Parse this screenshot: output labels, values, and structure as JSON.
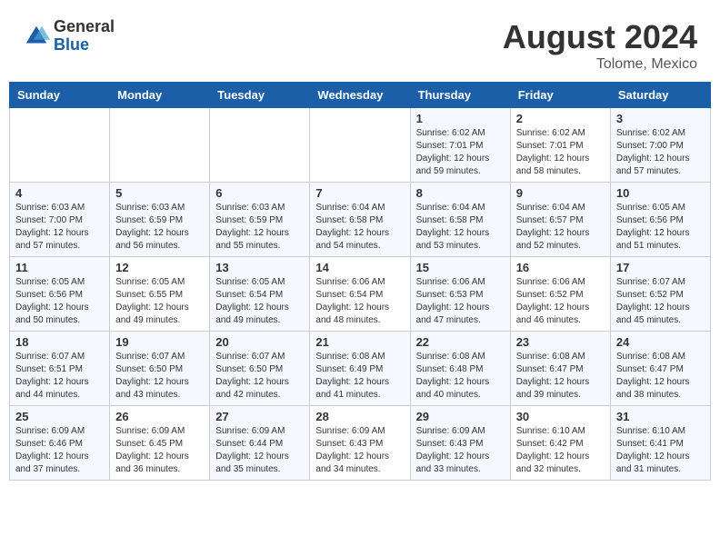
{
  "header": {
    "logo": {
      "general": "General",
      "blue": "Blue"
    },
    "month": "August 2024",
    "location": "Tolome, Mexico"
  },
  "weekdays": [
    "Sunday",
    "Monday",
    "Tuesday",
    "Wednesday",
    "Thursday",
    "Friday",
    "Saturday"
  ],
  "weeks": [
    [
      {
        "day": "",
        "info": ""
      },
      {
        "day": "",
        "info": ""
      },
      {
        "day": "",
        "info": ""
      },
      {
        "day": "",
        "info": ""
      },
      {
        "day": "1",
        "info": "Sunrise: 6:02 AM\nSunset: 7:01 PM\nDaylight: 12 hours\nand 59 minutes."
      },
      {
        "day": "2",
        "info": "Sunrise: 6:02 AM\nSunset: 7:01 PM\nDaylight: 12 hours\nand 58 minutes."
      },
      {
        "day": "3",
        "info": "Sunrise: 6:02 AM\nSunset: 7:00 PM\nDaylight: 12 hours\nand 57 minutes."
      }
    ],
    [
      {
        "day": "4",
        "info": "Sunrise: 6:03 AM\nSunset: 7:00 PM\nDaylight: 12 hours\nand 57 minutes."
      },
      {
        "day": "5",
        "info": "Sunrise: 6:03 AM\nSunset: 6:59 PM\nDaylight: 12 hours\nand 56 minutes."
      },
      {
        "day": "6",
        "info": "Sunrise: 6:03 AM\nSunset: 6:59 PM\nDaylight: 12 hours\nand 55 minutes."
      },
      {
        "day": "7",
        "info": "Sunrise: 6:04 AM\nSunset: 6:58 PM\nDaylight: 12 hours\nand 54 minutes."
      },
      {
        "day": "8",
        "info": "Sunrise: 6:04 AM\nSunset: 6:58 PM\nDaylight: 12 hours\nand 53 minutes."
      },
      {
        "day": "9",
        "info": "Sunrise: 6:04 AM\nSunset: 6:57 PM\nDaylight: 12 hours\nand 52 minutes."
      },
      {
        "day": "10",
        "info": "Sunrise: 6:05 AM\nSunset: 6:56 PM\nDaylight: 12 hours\nand 51 minutes."
      }
    ],
    [
      {
        "day": "11",
        "info": "Sunrise: 6:05 AM\nSunset: 6:56 PM\nDaylight: 12 hours\nand 50 minutes."
      },
      {
        "day": "12",
        "info": "Sunrise: 6:05 AM\nSunset: 6:55 PM\nDaylight: 12 hours\nand 49 minutes."
      },
      {
        "day": "13",
        "info": "Sunrise: 6:05 AM\nSunset: 6:54 PM\nDaylight: 12 hours\nand 49 minutes."
      },
      {
        "day": "14",
        "info": "Sunrise: 6:06 AM\nSunset: 6:54 PM\nDaylight: 12 hours\nand 48 minutes."
      },
      {
        "day": "15",
        "info": "Sunrise: 6:06 AM\nSunset: 6:53 PM\nDaylight: 12 hours\nand 47 minutes."
      },
      {
        "day": "16",
        "info": "Sunrise: 6:06 AM\nSunset: 6:52 PM\nDaylight: 12 hours\nand 46 minutes."
      },
      {
        "day": "17",
        "info": "Sunrise: 6:07 AM\nSunset: 6:52 PM\nDaylight: 12 hours\nand 45 minutes."
      }
    ],
    [
      {
        "day": "18",
        "info": "Sunrise: 6:07 AM\nSunset: 6:51 PM\nDaylight: 12 hours\nand 44 minutes."
      },
      {
        "day": "19",
        "info": "Sunrise: 6:07 AM\nSunset: 6:50 PM\nDaylight: 12 hours\nand 43 minutes."
      },
      {
        "day": "20",
        "info": "Sunrise: 6:07 AM\nSunset: 6:50 PM\nDaylight: 12 hours\nand 42 minutes."
      },
      {
        "day": "21",
        "info": "Sunrise: 6:08 AM\nSunset: 6:49 PM\nDaylight: 12 hours\nand 41 minutes."
      },
      {
        "day": "22",
        "info": "Sunrise: 6:08 AM\nSunset: 6:48 PM\nDaylight: 12 hours\nand 40 minutes."
      },
      {
        "day": "23",
        "info": "Sunrise: 6:08 AM\nSunset: 6:47 PM\nDaylight: 12 hours\nand 39 minutes."
      },
      {
        "day": "24",
        "info": "Sunrise: 6:08 AM\nSunset: 6:47 PM\nDaylight: 12 hours\nand 38 minutes."
      }
    ],
    [
      {
        "day": "25",
        "info": "Sunrise: 6:09 AM\nSunset: 6:46 PM\nDaylight: 12 hours\nand 37 minutes."
      },
      {
        "day": "26",
        "info": "Sunrise: 6:09 AM\nSunset: 6:45 PM\nDaylight: 12 hours\nand 36 minutes."
      },
      {
        "day": "27",
        "info": "Sunrise: 6:09 AM\nSunset: 6:44 PM\nDaylight: 12 hours\nand 35 minutes."
      },
      {
        "day": "28",
        "info": "Sunrise: 6:09 AM\nSunset: 6:43 PM\nDaylight: 12 hours\nand 34 minutes."
      },
      {
        "day": "29",
        "info": "Sunrise: 6:09 AM\nSunset: 6:43 PM\nDaylight: 12 hours\nand 33 minutes."
      },
      {
        "day": "30",
        "info": "Sunrise: 6:10 AM\nSunset: 6:42 PM\nDaylight: 12 hours\nand 32 minutes."
      },
      {
        "day": "31",
        "info": "Sunrise: 6:10 AM\nSunset: 6:41 PM\nDaylight: 12 hours\nand 31 minutes."
      }
    ]
  ]
}
